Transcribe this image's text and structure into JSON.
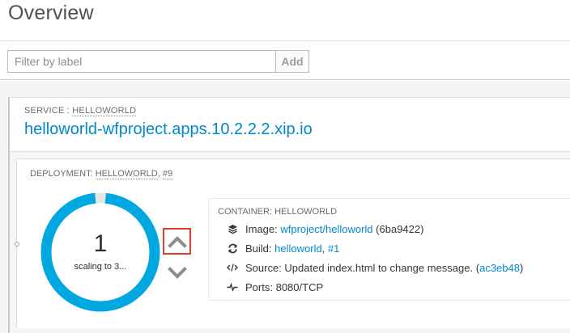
{
  "page": {
    "title": "Overview"
  },
  "filter": {
    "placeholder": "Filter by label",
    "add_label": "Add"
  },
  "service": {
    "label_prefix": "SERVICE : ",
    "label_name": "HELLOWORLD",
    "route": "helloworld-wfproject.apps.10.2.2.2.xip.io"
  },
  "deployment": {
    "label_prefix": "DEPLOYMENT: ",
    "label_name": "HELLOWORLD",
    "label_sep": ", ",
    "label_version": "#9",
    "pod_count": "1",
    "scaling_text": "scaling to 3...",
    "ring_color": "#00a8e1",
    "ring_fill": 0.97
  },
  "container": {
    "label": "CONTAINER: HELLOWORLD",
    "image_label": "Image:",
    "image_link": "wfproject/helloworld",
    "image_id": "(6ba9422)",
    "build_label": "Build:",
    "build_link": "helloworld",
    "build_sep": ",",
    "build_number": "#1",
    "source_label": "Source: Updated index.html to change message.",
    "source_open": "(",
    "source_commit": "ac3eb48",
    "source_close": ")",
    "ports_label": "Ports:",
    "ports_value": "8080/TCP"
  },
  "icons": {
    "image": "layers-icon",
    "build": "refresh-icon",
    "source": "code-icon",
    "ports": "pulse-icon",
    "scale_up": "chevron-up-icon",
    "scale_down": "chevron-down-icon"
  },
  "colors": {
    "link": "#0088ce",
    "highlight": "#e03e2d",
    "chevron": "#8b8d8f"
  }
}
